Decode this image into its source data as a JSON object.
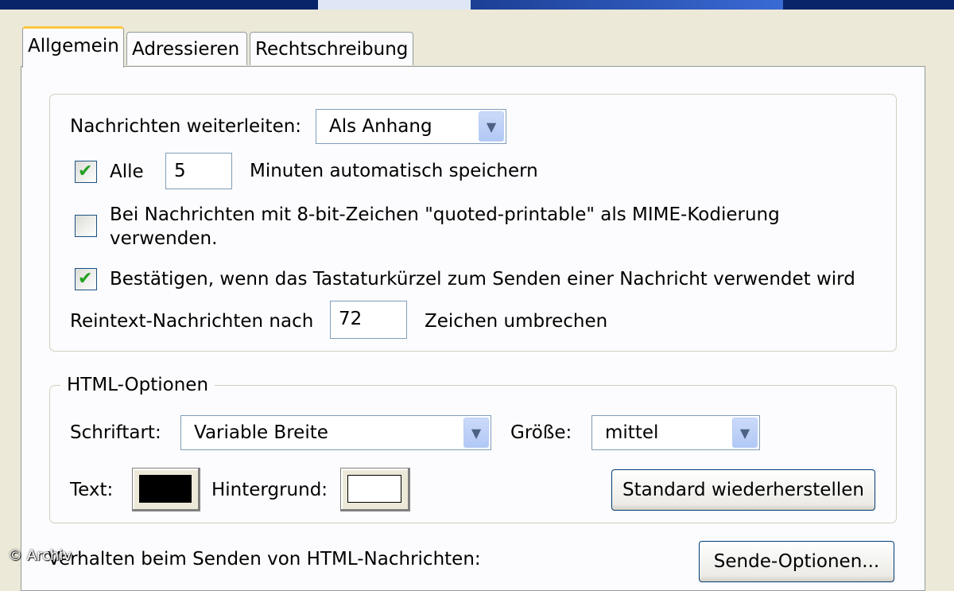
{
  "tabs": [
    {
      "label": "Allgemein",
      "active": true
    },
    {
      "label": "Adressieren",
      "active": false
    },
    {
      "label": "Rechtschreibung",
      "active": false
    }
  ],
  "forward": {
    "label": "Nachrichten weiterleiten:",
    "value": "Als Anhang"
  },
  "autosave": {
    "checked": true,
    "label": "Alle",
    "value": "5",
    "suffix": "Minuten automatisch speichern"
  },
  "quoted_printable": {
    "checked": false,
    "line1": "Bei Nachrichten mit 8-bit-Zeichen \"quoted-printable\" als MIME-Kodierung",
    "line2": "verwenden."
  },
  "confirm_shortcut": {
    "checked": true,
    "label": "Bestätigen, wenn das Tastaturkürzel zum Senden einer Nachricht verwendet wird"
  },
  "wrap": {
    "label": "Reintext-Nachrichten nach",
    "value": "72",
    "suffix": "Zeichen umbrechen"
  },
  "html_options": {
    "legend": "HTML-Optionen",
    "font_label": "Schriftart:",
    "font_value": "Variable Breite",
    "size_label": "Größe:",
    "size_value": "mittel",
    "text_label": "Text:",
    "text_color": "#000000",
    "background_label": "Hintergrund:",
    "background_color": "#ffffff",
    "restore_button": "Standard wiederherstellen"
  },
  "send_behavior": {
    "label": "Verhalten beim Senden von HTML-Nachrichten:",
    "button": "Sende-Optionen..."
  },
  "watermark": "© Archiv"
}
